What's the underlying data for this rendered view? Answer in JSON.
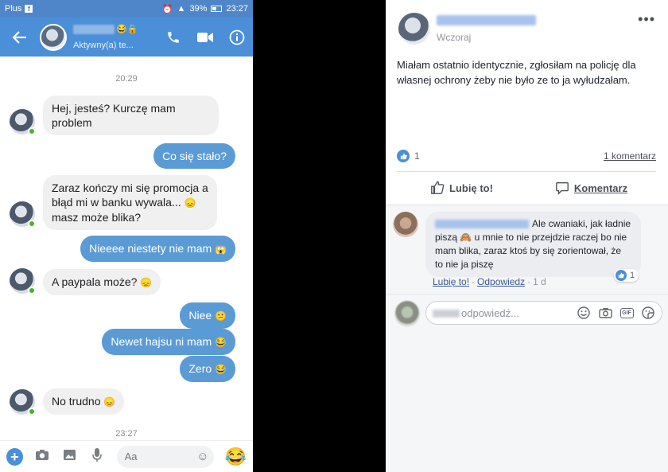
{
  "phone": {
    "status_bar": {
      "carrier": "Plus",
      "battery": "39%",
      "time": "23:27"
    },
    "header": {
      "name_emojis": "😂🔒",
      "status": "Aktywny(a) te..."
    },
    "timestamps": [
      "20:29",
      "23:27"
    ],
    "messages": [
      {
        "dir": "in",
        "line1": "Hej, jesteś? Kurczę mam",
        "line2": "problem"
      },
      {
        "dir": "out",
        "text": "Co się stało?"
      },
      {
        "dir": "in",
        "line1": "Zaraz kończy mi się promocja a",
        "line2": "błąd mi w banku wywala...",
        "emoji2": "😞",
        "line3": "masz może blika?"
      },
      {
        "dir": "out",
        "text": "Nieeee niestety nie mam",
        "emoji": "😱"
      },
      {
        "dir": "in",
        "text": "A paypala może?",
        "emoji": "😞"
      },
      {
        "dir": "out",
        "text": "Niee",
        "emoji": "😕"
      },
      {
        "dir": "out",
        "text": "Newet hajsu ni mam",
        "emoji": "😂"
      },
      {
        "dir": "out",
        "text": "Zero",
        "emoji": "😂"
      },
      {
        "dir": "in",
        "text": "No trudno",
        "emoji": "😞"
      }
    ],
    "composer": {
      "placeholder": "Aa",
      "big_emoji": "😂"
    },
    "colors": {
      "header": "#4a8fd8",
      "outgoing": "#5b9bd5",
      "incoming": "#f1f0f0"
    }
  },
  "fb_post": {
    "time": "Wczoraj",
    "text": "Miałam ostatnio identycznie, zgłosiłam na policję dla własnej ochrony żeby nie było ze to ja wyłudzałam.",
    "like_count": "1",
    "comments_count": "1 komentarz",
    "actions": {
      "like": "Lubię to!",
      "comment": "Komentarz"
    },
    "comment": {
      "text_a": "Ale cwaniaki, jak ładnie piszą",
      "emoji": "🙈",
      "text_b": "u mnie to nie przejdzie raczej bo nie mam blika, zaraz ktoś by się zorientował, że to nie ja piszę",
      "reaction_count": "1",
      "like_link": "Lubię to!",
      "reply_link": "Odpowiedz",
      "age": "1 d"
    },
    "reply_placeholder": "odpowiedź...",
    "icons": [
      "like-icon",
      "comment-icon",
      "emoji-icon",
      "camera-icon",
      "gif-icon",
      "sticker-icon"
    ]
  }
}
